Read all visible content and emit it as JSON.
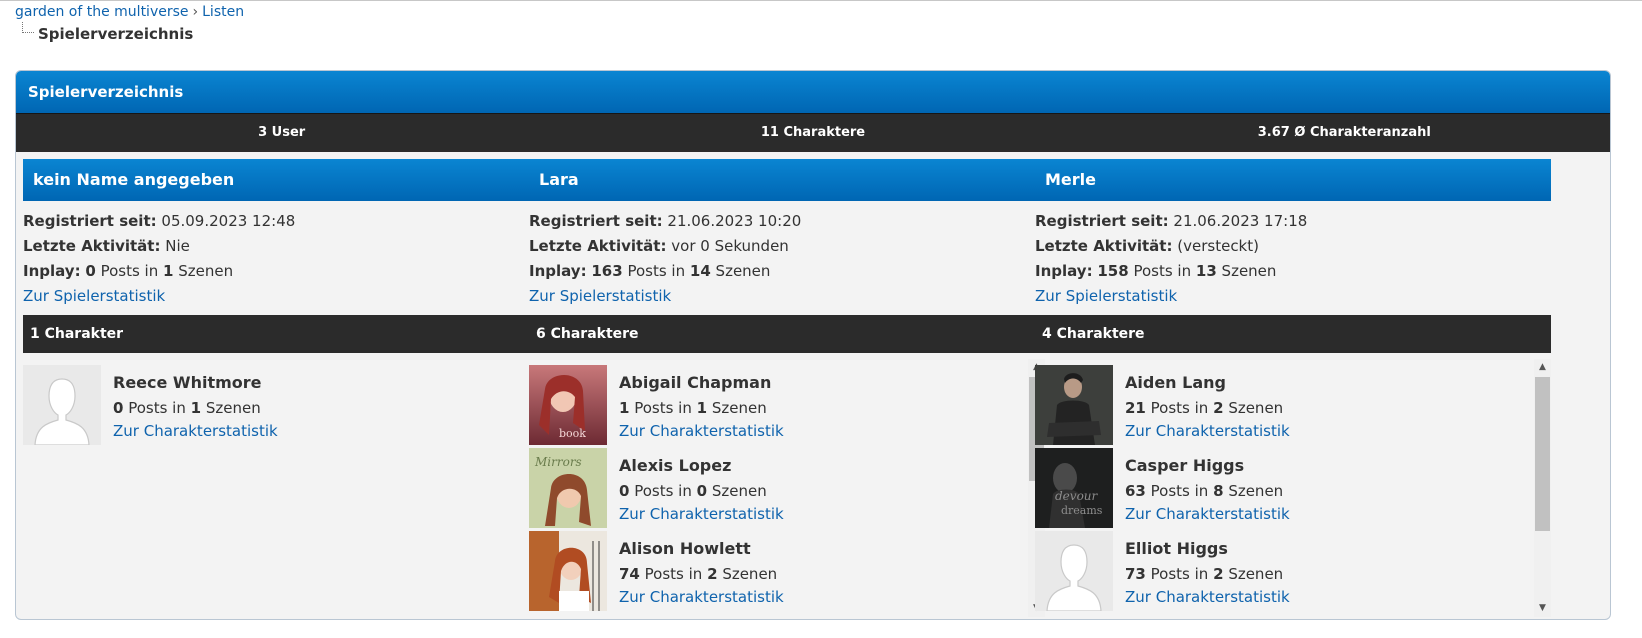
{
  "breadcrumb": {
    "forum": "garden of the multiverse",
    "separator": "›",
    "section": "Listen",
    "current": "Spielerverzeichnis"
  },
  "panel": {
    "title": "Spielerverzeichnis",
    "stats": [
      "3 User",
      "11 Charaktere",
      "3.67 Ø Charakteranzahl"
    ]
  },
  "labels": {
    "registered": "Registriert seit:",
    "last_activity": "Letzte Aktivität:",
    "inplay": "Inplay:",
    "posts_in": "Posts in",
    "scenes": "Szenen",
    "player_stats_link": "Zur Spielerstatistik",
    "char_stats_link": "Zur Charakterstatistik"
  },
  "colors": {
    "accent": "#0a7bc9",
    "dark": "#2b2b2b",
    "link": "#0f63ad"
  },
  "players": [
    {
      "name": "kein Name angegeben",
      "registered": "05.09.2023 12:48",
      "last_activity": "Nie",
      "inplay_posts": "0",
      "inplay_scenes": "1",
      "char_count_label": "1 Charakter",
      "characters": [
        {
          "name": "Reece Whitmore",
          "posts": "0",
          "scenes": "1",
          "avatar": "default-avatar"
        }
      ]
    },
    {
      "name": "Lara",
      "registered": "21.06.2023 10:20",
      "last_activity": "vor 0 Sekunden",
      "inplay_posts": "163",
      "inplay_scenes": "14",
      "char_count_label": "6 Charaktere",
      "characters": [
        {
          "name": "Abigail Chapman",
          "posts": "1",
          "scenes": "1",
          "avatar": "photo-red-hair"
        },
        {
          "name": "Alexis Lopez",
          "posts": "0",
          "scenes": "0",
          "avatar": "photo-green"
        },
        {
          "name": "Alison Howlett",
          "posts": "74",
          "scenes": "2",
          "avatar": "photo-orange"
        }
      ]
    },
    {
      "name": "Merle",
      "registered": "21.06.2023 17:18",
      "last_activity": "(versteckt)",
      "inplay_posts": "158",
      "inplay_scenes": "13",
      "char_count_label": "4 Charaktere",
      "characters": [
        {
          "name": "Aiden Lang",
          "posts": "21",
          "scenes": "2",
          "avatar": "photo-dark-man"
        },
        {
          "name": "Casper Higgs",
          "posts": "63",
          "scenes": "8",
          "avatar": "photo-dark-text"
        },
        {
          "name": "Elliot Higgs",
          "posts": "73",
          "scenes": "2",
          "avatar": "default-avatar"
        }
      ]
    }
  ]
}
